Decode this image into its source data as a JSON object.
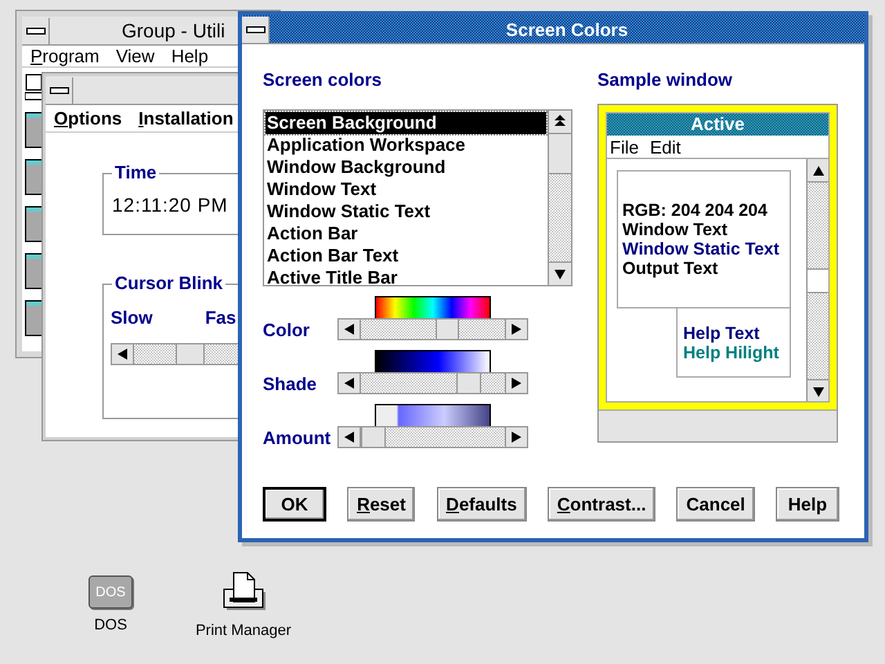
{
  "desktop_icons": [
    {
      "kind": "dos",
      "badge": "DOS",
      "label": "DOS"
    },
    {
      "kind": "printer",
      "label": "Print Manager"
    }
  ],
  "group_window": {
    "title": "Group - Utili",
    "menu": [
      {
        "label": "Program",
        "underlined_first": true
      },
      {
        "label": "View",
        "underlined_first": false
      },
      {
        "label": "Help",
        "underlined_first": false
      }
    ]
  },
  "clock_window": {
    "menu": [
      {
        "label": "Options",
        "underlined_first": true
      },
      {
        "label": "Installation",
        "underlined_first": true
      }
    ],
    "time_group": {
      "label": "Time",
      "value": "12:11:20 PM"
    },
    "blink_group": {
      "label": "Cursor Blink",
      "slow": "Slow",
      "fast": "Fas",
      "level": 0.3
    }
  },
  "dialog": {
    "title": "Screen Colors",
    "list_label": "Screen colors",
    "items": [
      {
        "label": "Screen Background",
        "selected": true
      },
      {
        "label": "Application Workspace",
        "selected": false
      },
      {
        "label": "Window Background",
        "selected": false
      },
      {
        "label": "Window Text",
        "selected": false
      },
      {
        "label": "Window Static Text",
        "selected": false
      },
      {
        "label": "Action Bar",
        "selected": false
      },
      {
        "label": "Action Bar Text",
        "selected": false
      },
      {
        "label": "Active Title Bar",
        "selected": false
      }
    ],
    "sliders": [
      {
        "label": "Color",
        "kind": "hue",
        "level": 0.62
      },
      {
        "label": "Shade",
        "kind": "shade",
        "level": 0.8
      },
      {
        "label": "Amount",
        "kind": "amount",
        "level": 0
      }
    ],
    "sample": {
      "label": "Sample window",
      "title": "Active",
      "menu": [
        "File",
        "Edit"
      ],
      "lines": [
        {
          "text": "RGB: 204 204 204",
          "color": "#000000"
        },
        {
          "text": "Window Text",
          "color": "#000000"
        },
        {
          "text": "Window Static Text",
          "color": "#000080"
        },
        {
          "text": "Output Text",
          "color": "#000000"
        }
      ],
      "help_lines": [
        {
          "text": "Help Text",
          "color": "#000080"
        },
        {
          "text": "Help Hilight",
          "color": "#008080"
        }
      ]
    },
    "buttons": [
      {
        "label": "OK",
        "default": true,
        "underlined_first": false
      },
      {
        "label": "Reset",
        "default": false,
        "underlined_first": true
      },
      {
        "label": "Defaults",
        "default": false,
        "underlined_first": true
      },
      {
        "label": "Contrast...",
        "default": false,
        "underlined_first": true
      },
      {
        "label": "Cancel",
        "default": false,
        "underlined_first": false
      },
      {
        "label": "Help",
        "default": false,
        "underlined_first": false
      }
    ]
  }
}
